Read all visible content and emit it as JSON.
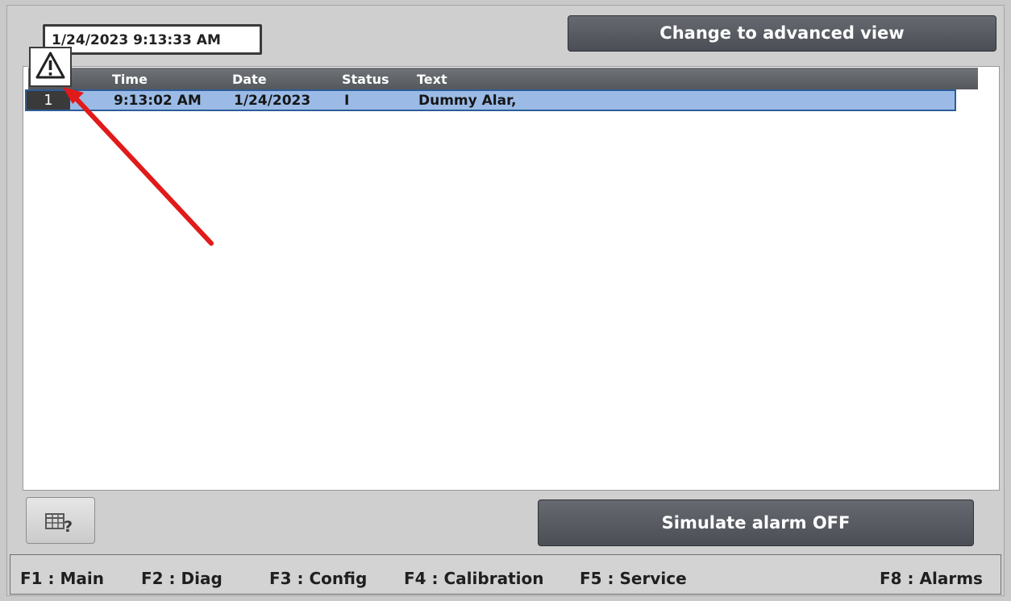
{
  "header": {
    "datetime": "1/24/2023 9:13:33 AM",
    "advanced_view_label": "Change to advanced view"
  },
  "alarm_view": {
    "columns": [
      "Time",
      "Date",
      "Status",
      "Text"
    ],
    "rows": [
      {
        "number": "1",
        "time": "9:13:02 AM",
        "date": "1/24/2023",
        "status": "I",
        "text": "Dummy Alar,"
      }
    ]
  },
  "footer": {
    "simulate_label": "Simulate alarm OFF",
    "function_keys": [
      {
        "label": "F1 : Main"
      },
      {
        "label": "F2 : Diag"
      },
      {
        "label": "F3 : Config"
      },
      {
        "label": "F4 : Calibration"
      },
      {
        "label": "F5 : Service"
      },
      {
        "label": "F8 : Alarms"
      }
    ]
  },
  "icons": {
    "warning": "warning-triangle-icon",
    "help": "table-help-icon"
  },
  "colors": {
    "button_dark": "#55595d",
    "row_selected": "#9bbbe6",
    "row_border": "#2d5c9a",
    "header_bg": "#5f6367",
    "annotation_arrow": "#e11a1a"
  }
}
